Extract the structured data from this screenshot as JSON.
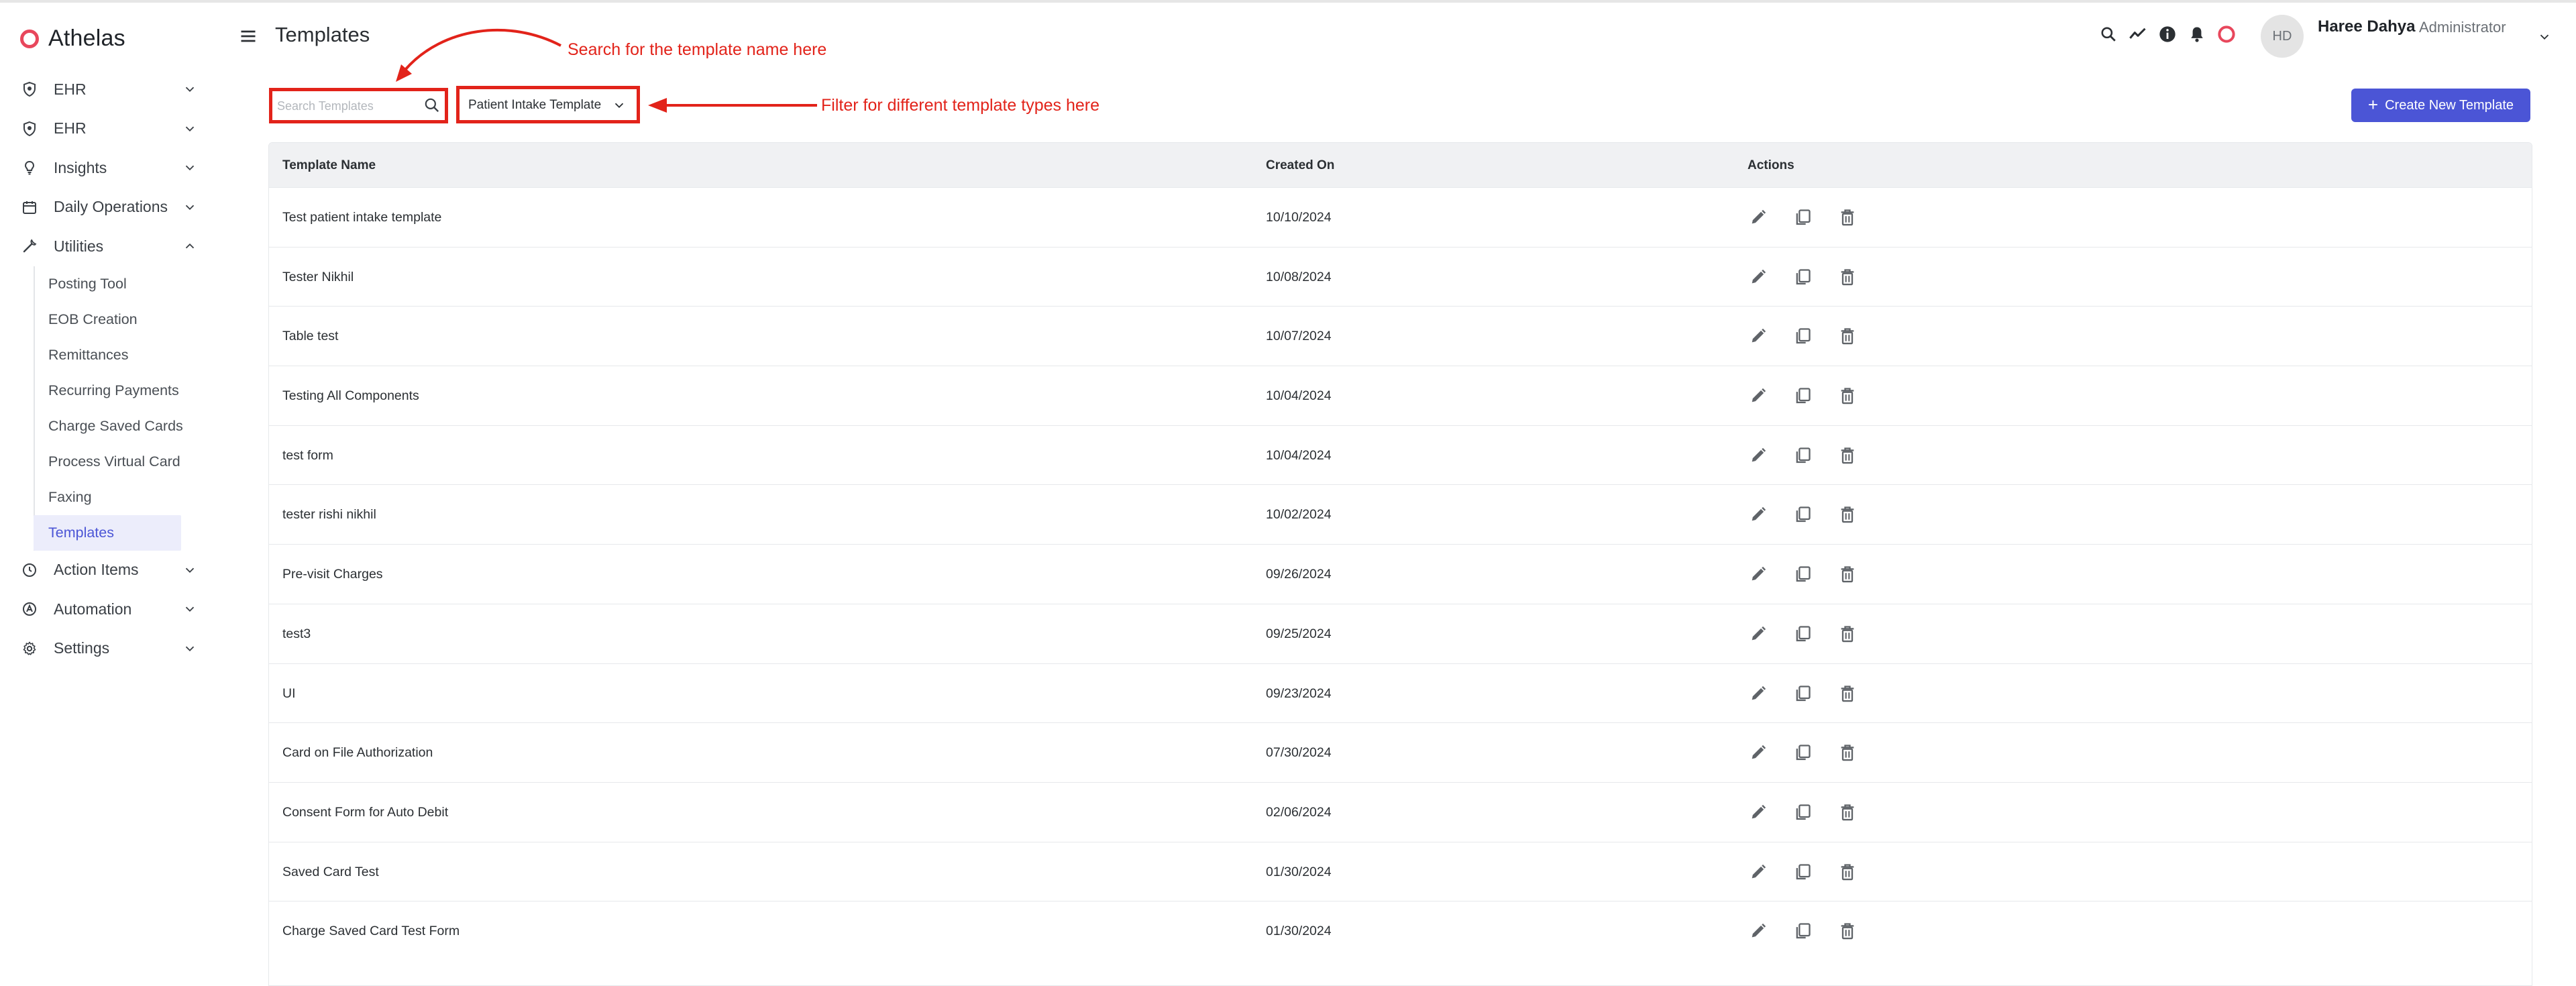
{
  "brand": {
    "name": "Athelas",
    "accent": "#e8475c"
  },
  "sidebar": {
    "items": [
      {
        "label": "EHR",
        "icon": "shield-icon",
        "expandable": true
      },
      {
        "label": "EHR",
        "icon": "shield-icon",
        "expandable": true
      },
      {
        "label": "Insights",
        "icon": "lightbulb-icon",
        "expandable": true
      },
      {
        "label": "Daily Operations",
        "icon": "calendar-icon",
        "expandable": true
      },
      {
        "label": "Utilities",
        "icon": "wrench-icon",
        "expanded": true
      },
      {
        "label": "Action Items",
        "icon": "clock-icon",
        "expandable": true
      },
      {
        "label": "Automation",
        "icon": "automation-icon",
        "expandable": true
      },
      {
        "label": "Settings",
        "icon": "gear-icon",
        "expandable": true
      }
    ],
    "utilities_sub": [
      "Posting Tool",
      "EOB Creation",
      "Remittances",
      "Recurring Payments",
      "Charge Saved Cards",
      "Process Virtual Card",
      "Faxing",
      "Templates"
    ],
    "active_sub": "Templates"
  },
  "header": {
    "title": "Templates",
    "icons": [
      "search-icon",
      "trending-icon",
      "info-icon",
      "bell-icon",
      "athelas-ring-icon"
    ],
    "user": {
      "initials": "HD",
      "name": "Haree Dahya",
      "role": "Administrator"
    }
  },
  "toolbar": {
    "search_placeholder": "Search Templates",
    "filter_value": "Patient Intake Template",
    "create_label": "Create New Template"
  },
  "annotations": {
    "search_note": "Search for the template name here",
    "filter_note": "Filter for different template types here",
    "color": "#e2231a"
  },
  "table": {
    "columns": [
      "Template Name",
      "Created On",
      "Actions"
    ],
    "rows": [
      {
        "name": "Test patient intake template",
        "created": "10/10/2024"
      },
      {
        "name": "Tester Nikhil",
        "created": "10/08/2024"
      },
      {
        "name": "Table test",
        "created": "10/07/2024"
      },
      {
        "name": "Testing All Components",
        "created": "10/04/2024"
      },
      {
        "name": "test form",
        "created": "10/04/2024"
      },
      {
        "name": "tester rishi nikhil",
        "created": "10/02/2024"
      },
      {
        "name": "Pre-visit Charges",
        "created": "09/26/2024"
      },
      {
        "name": "test3",
        "created": "09/25/2024"
      },
      {
        "name": "UI",
        "created": "09/23/2024"
      },
      {
        "name": "Card on File Authorization",
        "created": "07/30/2024"
      },
      {
        "name": "Consent Form for Auto Debit",
        "created": "02/06/2024"
      },
      {
        "name": "Saved Card Test",
        "created": "01/30/2024"
      },
      {
        "name": "Charge Saved Card Test Form",
        "created": "01/30/2024"
      }
    ],
    "row_actions": [
      "edit-icon",
      "copy-icon",
      "delete-icon"
    ]
  },
  "colors": {
    "primary": "#4b55d6",
    "header_bg": "#f0f1f3",
    "annotation": "#e2231a"
  }
}
